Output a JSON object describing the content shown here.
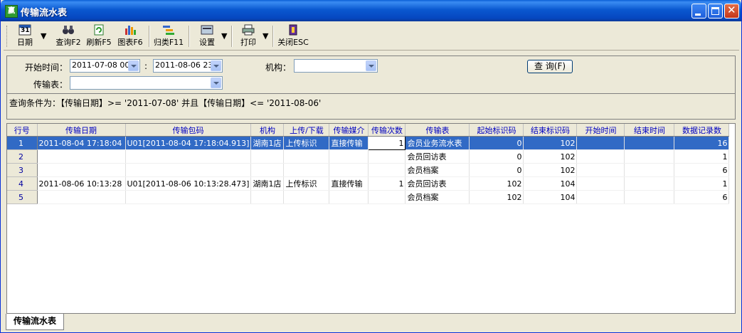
{
  "window": {
    "title": "传输流水表",
    "app_icon_glyph": "赢"
  },
  "toolbar": {
    "date": "日期",
    "query": "查询F2",
    "refresh": "刷新F5",
    "chart": "图表F6",
    "group": "归类F11",
    "settings": "设置",
    "print": "打印",
    "close": "关闭ESC",
    "calendar_day": "31"
  },
  "filters": {
    "start_label": "开始时间：",
    "start_value": "2011-07-08 00",
    "to_label": ":",
    "end_value": "2011-08-06 23",
    "org_label": "机构：",
    "org_value": "",
    "table_label": "传输表：",
    "table_value": "",
    "query_button": "查 询(F)",
    "condition": "查询条件为：【传输日期】>= '2011-07-08' 并且【传输日期】<= '2011-08-06'"
  },
  "grid": {
    "columns": [
      "行号",
      "传输日期",
      "传输包码",
      "机构",
      "上传/下载",
      "传输媒介",
      "传输次数",
      "传输表",
      "起始标识码",
      "结束标识码",
      "开始时间",
      "结束时间",
      "数据记录数"
    ],
    "rows": [
      [
        "1",
        "2011-08-04 17:18:04",
        "U01[2011-08-04 17:18:04.913]",
        "湖南1店",
        "上传标识",
        "直接传输",
        "1",
        "会员业务流水表",
        "0",
        "102",
        "",
        "",
        "16"
      ],
      [
        "2",
        "",
        "",
        "",
        "",
        "",
        "",
        "会员回访表",
        "0",
        "102",
        "",
        "",
        "1"
      ],
      [
        "3",
        "",
        "",
        "",
        "",
        "",
        "",
        "会员档案",
        "0",
        "102",
        "",
        "",
        "6"
      ],
      [
        "4",
        "2011-08-06 10:13:28",
        "U01[2011-08-06 10:13:28.473]",
        "湖南1店",
        "上传标识",
        "直接传输",
        "1",
        "会员回访表",
        "102",
        "104",
        "",
        "",
        "1"
      ],
      [
        "5",
        "",
        "",
        "",
        "",
        "",
        "",
        "会员档案",
        "102",
        "104",
        "",
        "",
        "6"
      ]
    ]
  },
  "tabs": [
    {
      "label": "传输流水表"
    }
  ],
  "colors": {
    "title_bar": "#0a58d0",
    "selection": "#316ac5",
    "header_text": "#0000c0"
  },
  "icons": [
    "calendar-icon",
    "binoculars-icon",
    "refresh-icon",
    "bar-chart-icon",
    "group-icon",
    "settings-icon",
    "printer-icon",
    "exit-icon"
  ]
}
